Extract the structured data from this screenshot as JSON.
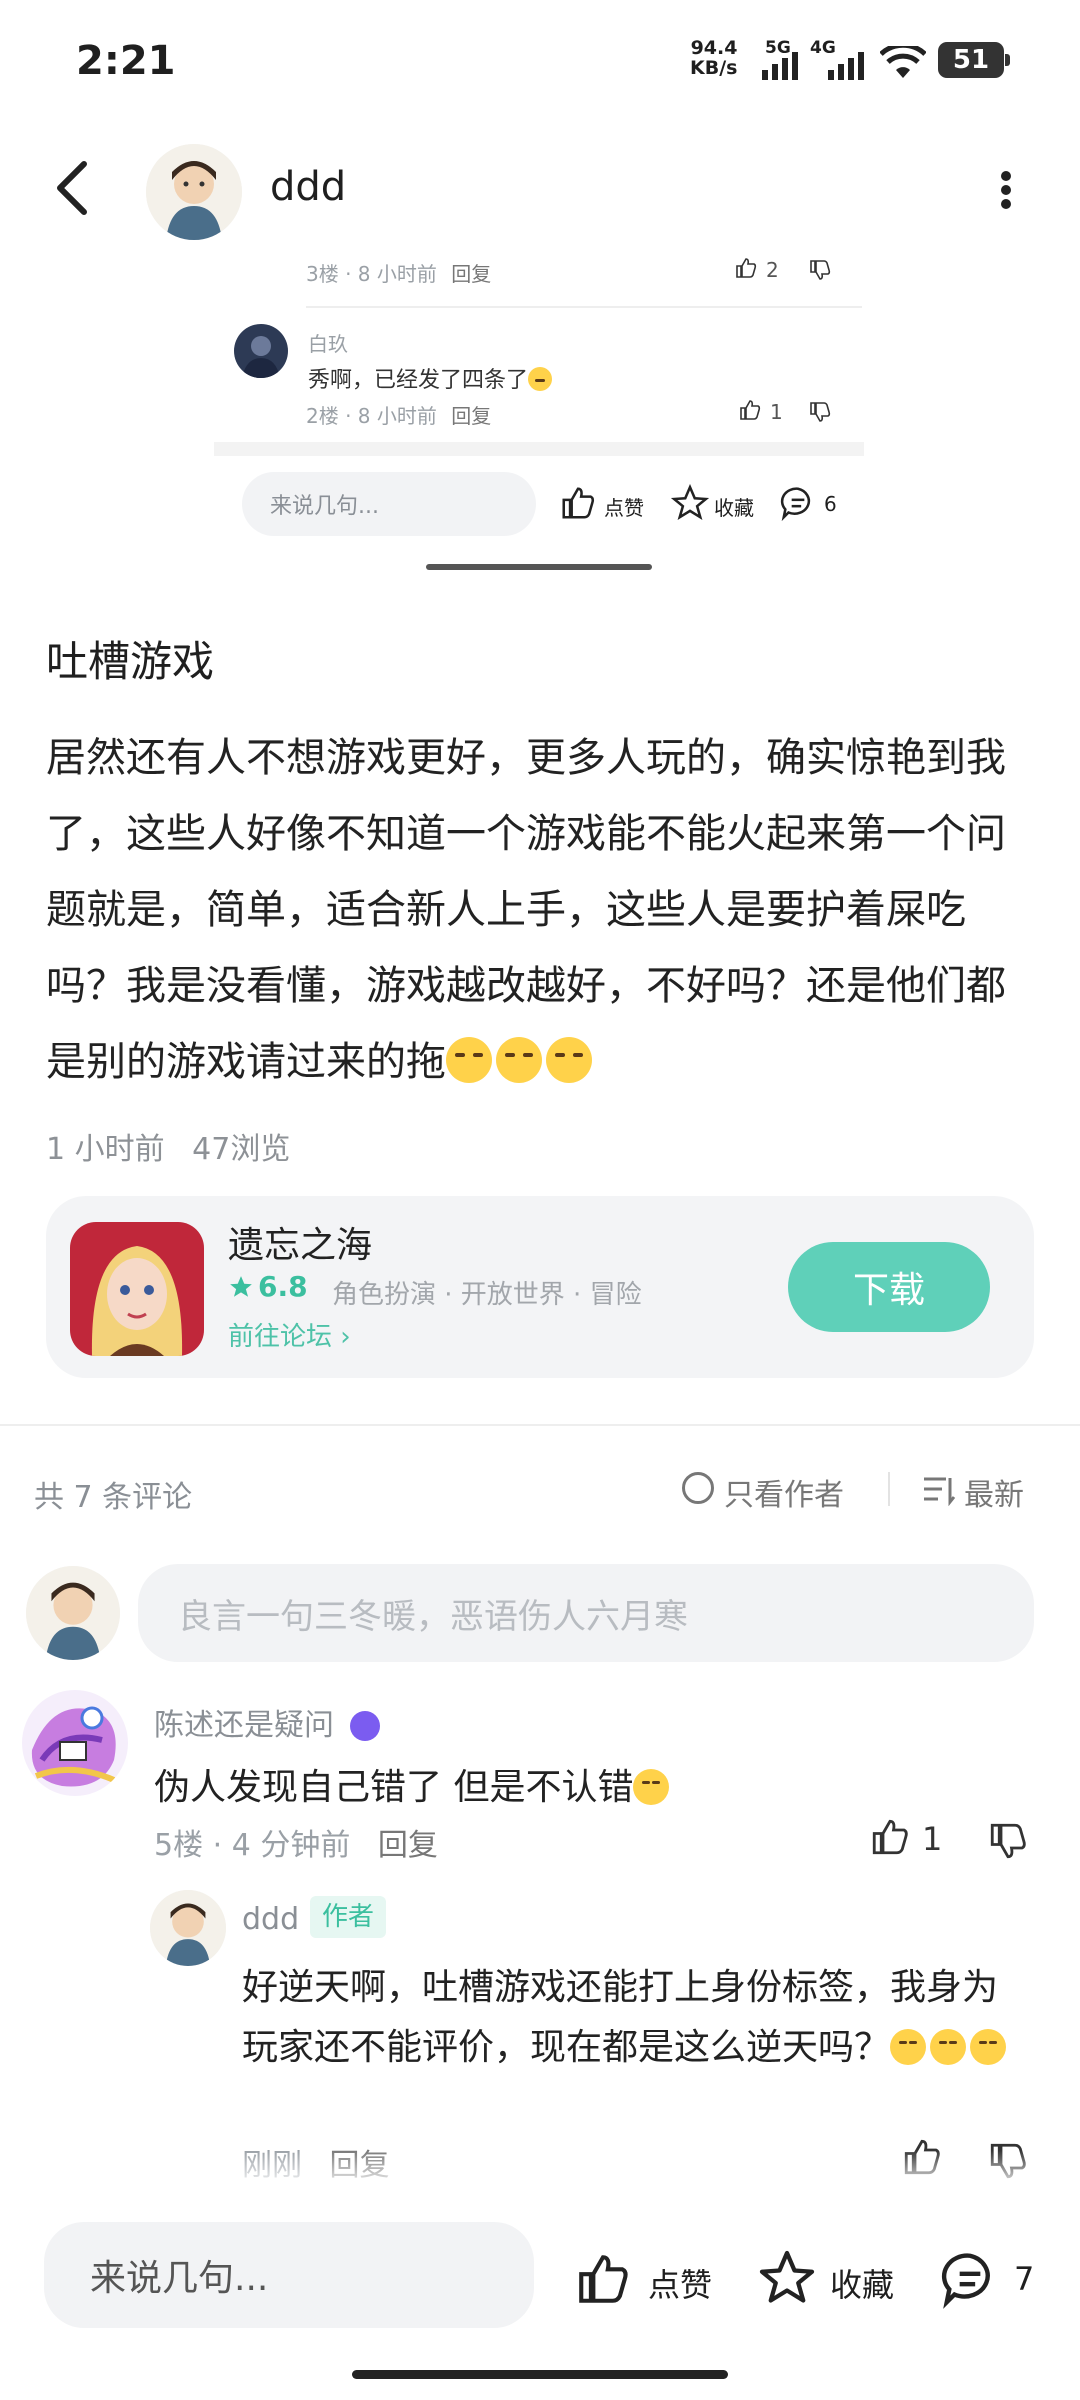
{
  "status_bar": {
    "time": "2:21",
    "net_speed_value": "94.4",
    "net_speed_unit": "KB/s",
    "sim1": "5G",
    "sim2": "4G",
    "battery": "51"
  },
  "header": {
    "username": "ddd"
  },
  "preview": {
    "reply1_meta": "3楼 · 8 小时前",
    "reply1_reply": "回复",
    "reply1_likes": "2",
    "reply2_user": "白玖",
    "reply2_text": "秀啊，已经发了四条了",
    "reply2_meta": "2楼 · 8 小时前",
    "reply2_reply": "回复",
    "reply2_likes": "1",
    "input_placeholder": "来说几句...",
    "like_label": "点赞",
    "fav_label": "收藏",
    "comment_count": "6"
  },
  "post": {
    "title": "吐槽游戏",
    "body": "居然还有人不想游戏更好，更多人玩的，确实惊艳到我了，这些人好像不知道一个游戏能不能火起来第一个问题就是，简单，适合新人上手，这些人是要护着屎吃吗？我是没看懂，游戏越改越好，不好吗？还是他们都是别的游戏请过来的拖",
    "time": "1 小时前",
    "views": "47浏览"
  },
  "game": {
    "name": "遗忘之海",
    "rating": "6.8",
    "tags": "角色扮演 · 开放世界 · 冒险",
    "forum_link": "前往论坛",
    "download_label": "下载"
  },
  "comments_section": {
    "count_label": "共 7 条评论",
    "author_only_label": "只看作者",
    "sort_label": "最新",
    "input_placeholder": "良言一句三冬暖，恶语伤人六月寒"
  },
  "comments": [
    {
      "user": "陈述还是疑问",
      "text": "伪人发现自己错了  但是不认错",
      "meta": "5楼 · 4 分钟前",
      "reply_label": "回复",
      "likes": "1"
    }
  ],
  "reply": {
    "user": "ddd",
    "badge": "作者",
    "text": "好逆天啊，吐槽游戏还能打上身份标签，我身为玩家还不能评价，现在都是这么逆天吗？",
    "time": "刚刚",
    "reply_label": "回复"
  },
  "bottom_bar": {
    "input_placeholder": "来说几句...",
    "like_label": "点赞",
    "fav_label": "收藏",
    "comment_count": "7"
  },
  "colors": {
    "accent": "#4ec2a8",
    "download_button": "#5fd0b9",
    "star": "#3bbf9f"
  }
}
